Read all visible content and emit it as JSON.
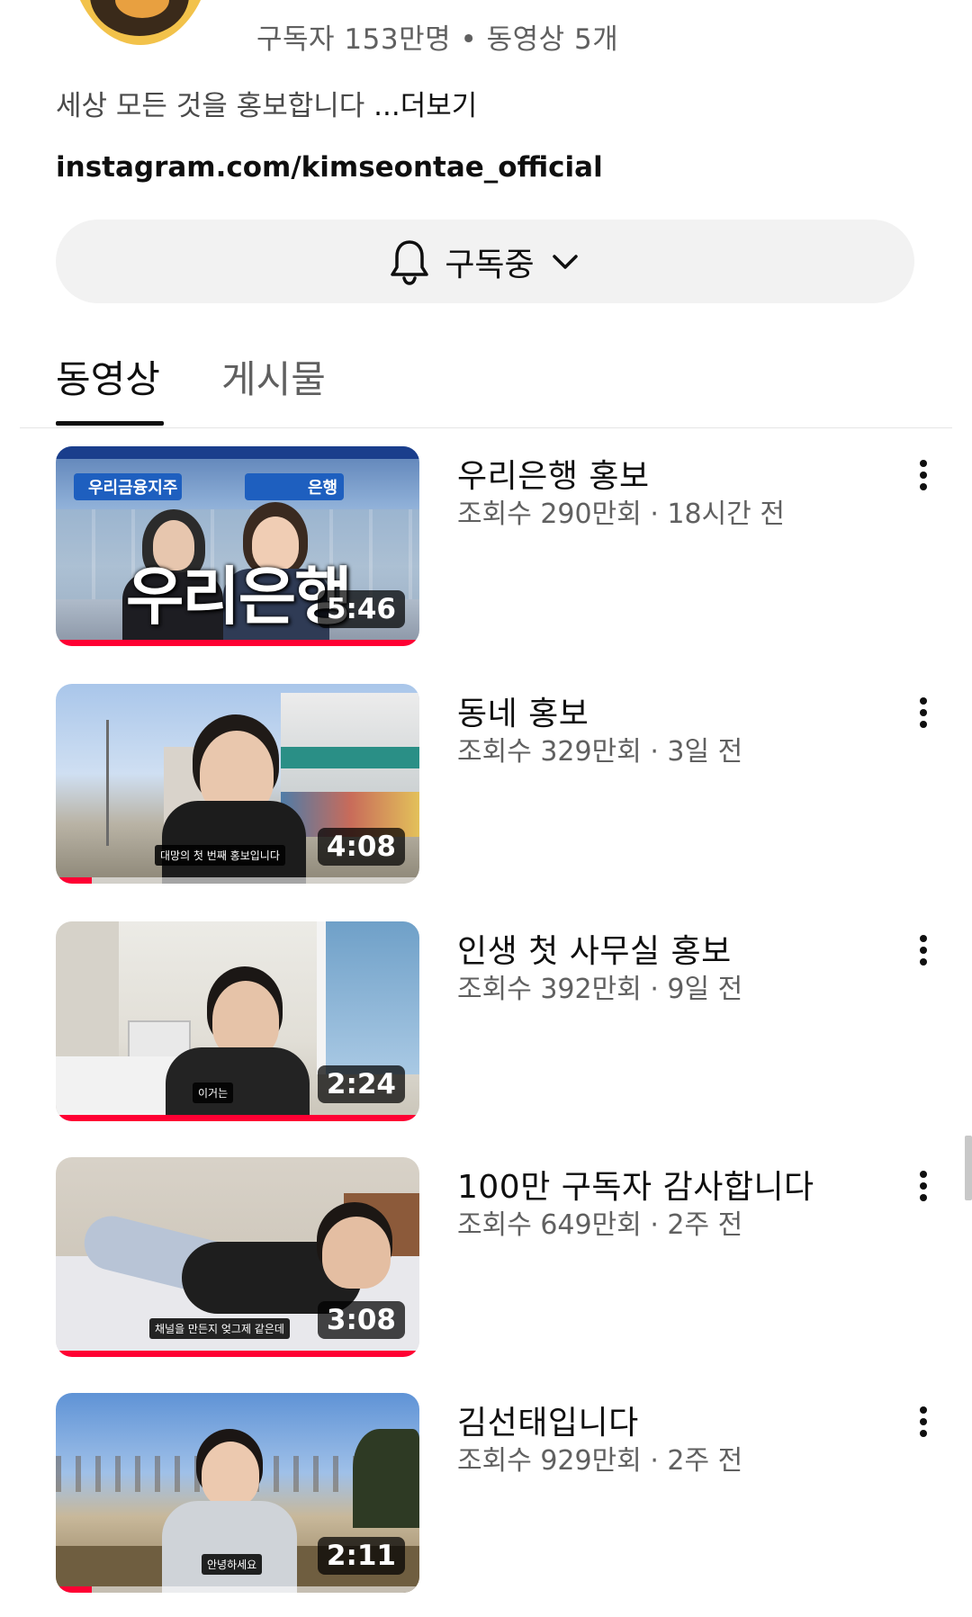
{
  "channel": {
    "stats": "구독자 153만명 • 동영상 5개",
    "description": "세상 모든 것을 홍보합니다",
    "more_label": "...더보기",
    "link": "instagram.com/kimseontae_official",
    "subscribe_label": "구독중"
  },
  "tabs": [
    {
      "label": "동영상",
      "active": true
    },
    {
      "label": "게시물",
      "active": false
    }
  ],
  "videos": [
    {
      "title": "우리은행 홍보",
      "meta": "조회수 290만회 · 18시간 전",
      "duration": "5:46",
      "overlay_text": "우리은행",
      "sign_text": "우리금융지주",
      "sign_text2": "은행",
      "caption": "",
      "progress": 1.0
    },
    {
      "title": "동네 홍보",
      "meta": "조회수 329만회 · 3일 전",
      "duration": "4:08",
      "overlay_text": "",
      "caption": "대망의 첫 번째 홍보입니다",
      "progress": 0.1
    },
    {
      "title": "인생 첫 사무실 홍보",
      "meta": "조회수 392만회 · 9일 전",
      "duration": "2:24",
      "overlay_text": "",
      "caption": "이거는",
      "progress": 1.0
    },
    {
      "title": "100만 구독자 감사합니다",
      "meta": "조회수 649만회 · 2주 전",
      "duration": "3:08",
      "overlay_text": "",
      "caption": "채널을 만든지 엊그제 같은데",
      "progress": 1.0
    },
    {
      "title": "김선태입니다",
      "meta": "조회수 929만회 · 2주 전",
      "duration": "2:11",
      "overlay_text": "",
      "caption": "안녕하세요",
      "progress": 0.1
    }
  ],
  "colors": {
    "progress": "#ff0033",
    "secondary_text": "#606060",
    "button_bg": "#f2f2f2"
  },
  "icons": [
    "bell-icon",
    "chevron-down-icon",
    "more-vert-icon"
  ]
}
